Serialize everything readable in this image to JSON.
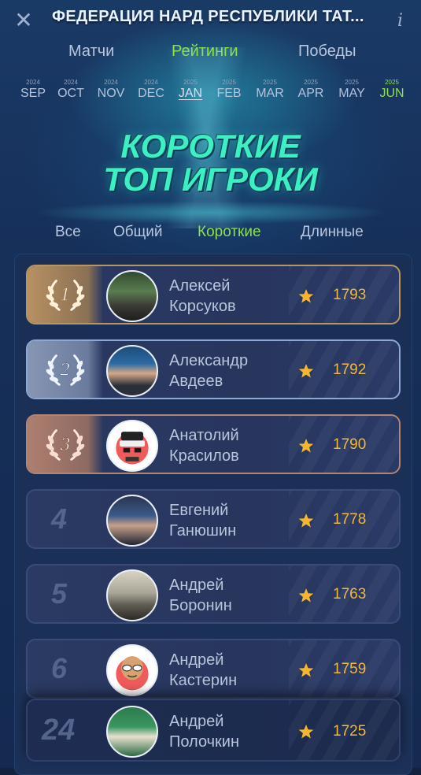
{
  "header": {
    "title": "ФЕДЕРАЦИЯ НАРД РЕСПУБЛИКИ ТАТ...",
    "close_icon": "close-icon",
    "info_icon": "info-icon"
  },
  "tabs": [
    {
      "label": "Матчи",
      "active": false
    },
    {
      "label": "Рейтинги",
      "active": true
    },
    {
      "label": "Победы",
      "active": false
    }
  ],
  "months": [
    {
      "year": "2024",
      "month": "SEP"
    },
    {
      "year": "2024",
      "month": "OCT"
    },
    {
      "year": "2024",
      "month": "NOV"
    },
    {
      "year": "2024",
      "month": "DEC"
    },
    {
      "year": "2025",
      "month": "JAN",
      "selected": true
    },
    {
      "year": "2025",
      "month": "FEB"
    },
    {
      "year": "2025",
      "month": "MAR"
    },
    {
      "year": "2025",
      "month": "APR"
    },
    {
      "year": "2025",
      "month": "MAY"
    },
    {
      "year": "2025",
      "month": "JUN",
      "current": true
    }
  ],
  "hero": {
    "line1": "КОРОТКИЕ",
    "line2": "ТОП ИГРОКИ"
  },
  "filters": [
    {
      "label": "Все",
      "active": false
    },
    {
      "label": "Общий",
      "active": false
    },
    {
      "label": "Короткие",
      "active": true
    },
    {
      "label": "Длинные",
      "active": false
    }
  ],
  "players": [
    {
      "rank": "1",
      "first": "Алексей",
      "last": "Корсуков",
      "score": "1793",
      "medal": "gold"
    },
    {
      "rank": "2",
      "first": "Александр",
      "last": "Авдеев",
      "score": "1792",
      "medal": "silver"
    },
    {
      "rank": "3",
      "first": "Анатолий",
      "last": "Красилов",
      "score": "1790",
      "medal": "bronze"
    },
    {
      "rank": "4",
      "first": "Евгений",
      "last": "Ганюшин",
      "score": "1778"
    },
    {
      "rank": "5",
      "first": "Андрей",
      "last": "Боронин",
      "score": "1763"
    },
    {
      "rank": "6",
      "first": "Андрей",
      "last": "Кастерин",
      "score": "1759"
    }
  ],
  "current_player": {
    "rank": "24",
    "first": "Андрей",
    "last": "Полочкин",
    "score": "1725"
  },
  "colors": {
    "accent": "#8ee04e",
    "score": "#f3b73a",
    "hero": "#3df0c3"
  }
}
